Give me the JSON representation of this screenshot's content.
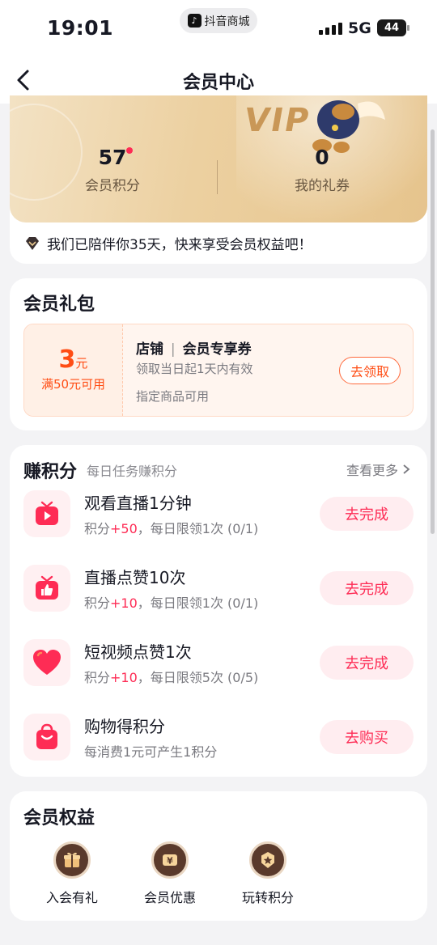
{
  "status_bar": {
    "time": "19:01",
    "app_badge": "抖音商城",
    "network": "5G",
    "battery": "44"
  },
  "nav": {
    "title": "会员中心"
  },
  "member": {
    "badge_text": "VIP",
    "points_value": "57",
    "points_label": "会员积分",
    "vouchers_value": "0",
    "vouchers_label": "我的礼券",
    "since_text": "我们已陪伴你35天，快来享受会员权益吧！"
  },
  "gift_pack": {
    "title": "会员礼包",
    "coupon": {
      "amount": "3",
      "unit": "元",
      "condition": "满50元可用",
      "title_a": "店铺",
      "title_b": "会员专享券",
      "validity": "领取当日起1天内有效",
      "scope": "指定商品可用",
      "button": "去领取"
    }
  },
  "points_tasks": {
    "title": "赚积分",
    "hint": "每日任务赚积分",
    "more": "查看更多",
    "tasks": [
      {
        "icon": "tv-play-icon",
        "name": "观看直播1分钟",
        "prefix": "积分",
        "plus": "+50",
        "suffix": "，每日限领1次 (0/1)",
        "button": "去完成"
      },
      {
        "icon": "tv-thumbs-up-icon",
        "name": "直播点赞10次",
        "prefix": "积分",
        "plus": "+10",
        "suffix": "，每日限领1次 (0/1)",
        "button": "去完成"
      },
      {
        "icon": "heart-icon",
        "name": "短视频点赞1次",
        "prefix": "积分",
        "plus": "+10",
        "suffix": "，每日限领5次 (0/5)",
        "button": "去完成"
      },
      {
        "icon": "shopping-bag-icon",
        "name": "购物得积分",
        "prefix": "每消费1元可产生1积分",
        "plus": "",
        "suffix": "",
        "button": "去购买"
      }
    ]
  },
  "rights": {
    "title": "会员权益",
    "items": [
      {
        "icon": "gift-icon",
        "label": "入会有礼"
      },
      {
        "icon": "yen-ticket-icon",
        "label": "会员优惠"
      },
      {
        "icon": "star-badge-icon",
        "label": "玩转积分"
      }
    ]
  },
  "colors": {
    "accent": "#fe2c55",
    "coupon_orange": "#ff4d14",
    "gold_bg": "#ecd0a0",
    "rights_icon_bg": "#5a3a2c"
  }
}
